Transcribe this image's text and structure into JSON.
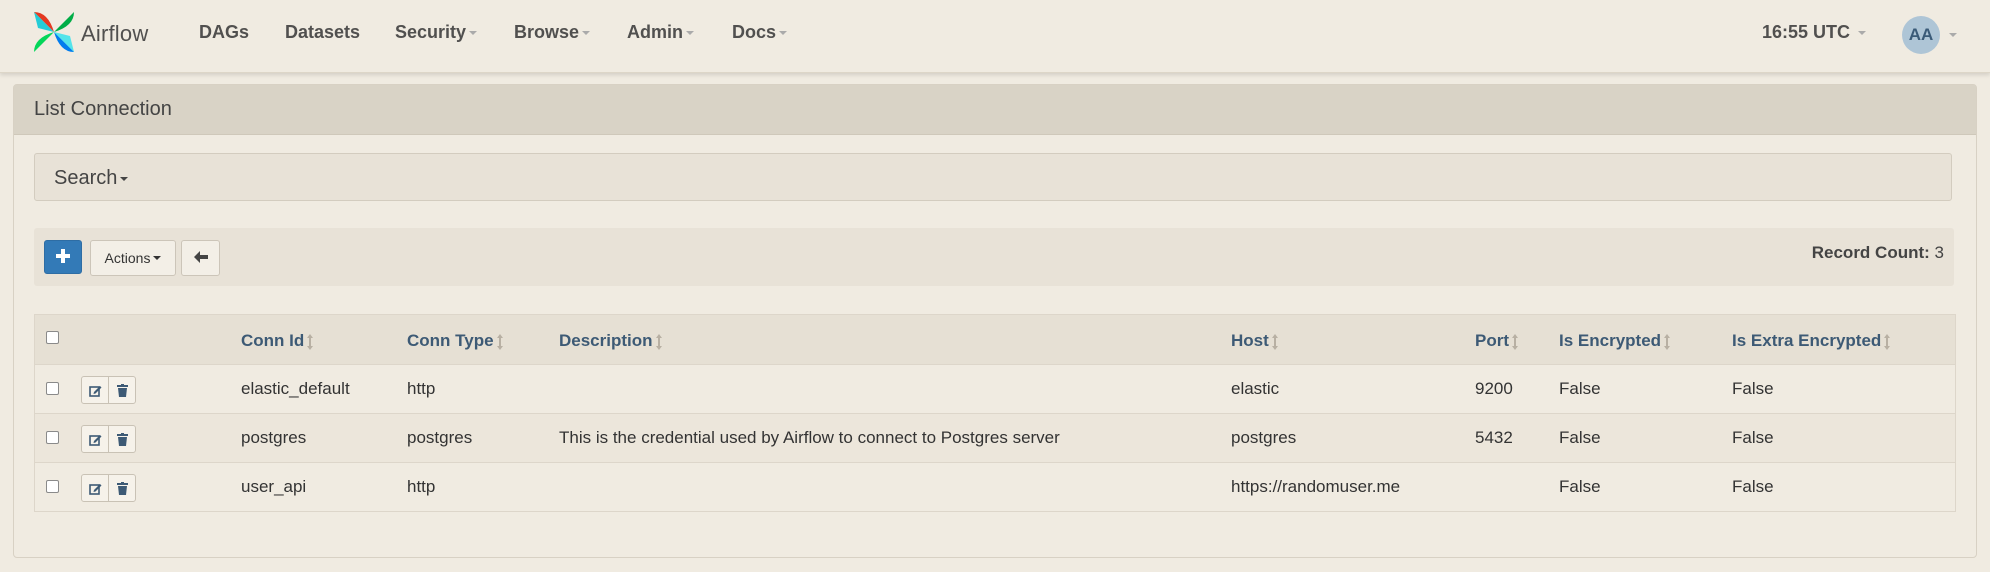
{
  "navbar": {
    "brand": "Airflow",
    "items": [
      {
        "label": "DAGs",
        "dropdown": false
      },
      {
        "label": "Datasets",
        "dropdown": false
      },
      {
        "label": "Security",
        "dropdown": true
      },
      {
        "label": "Browse",
        "dropdown": true
      },
      {
        "label": "Admin",
        "dropdown": true
      },
      {
        "label": "Docs",
        "dropdown": true
      }
    ],
    "time": "16:55 UTC",
    "user_initials": "AA"
  },
  "panel": {
    "title": "List Connection",
    "search_label": "Search"
  },
  "toolbar": {
    "add_icon": "plus-icon",
    "actions_label": "Actions",
    "back_icon": "arrow-left-icon",
    "record_count_label": "Record Count:",
    "record_count_value": "3"
  },
  "table": {
    "columns": [
      "Conn Id",
      "Conn Type",
      "Description",
      "Host",
      "Port",
      "Is Encrypted",
      "Is Extra Encrypted"
    ],
    "rows": [
      {
        "conn_id": "elastic_default",
        "conn_type": "http",
        "description": "",
        "host": "elastic",
        "port": "9200",
        "is_encrypted": "False",
        "is_extra_encrypted": "False"
      },
      {
        "conn_id": "postgres",
        "conn_type": "postgres",
        "description": "This is the credential used by Airflow to connect to Postgres server",
        "host": "postgres",
        "port": "5432",
        "is_encrypted": "False",
        "is_extra_encrypted": "False"
      },
      {
        "conn_id": "user_api",
        "conn_type": "http",
        "description": "",
        "host": "https://randomuser.me",
        "port": "",
        "is_encrypted": "False",
        "is_extra_encrypted": "False"
      }
    ]
  },
  "colors": {
    "background": "#f0ebe1",
    "primary_button": "#337ab7",
    "header_link": "#3d5a75"
  }
}
